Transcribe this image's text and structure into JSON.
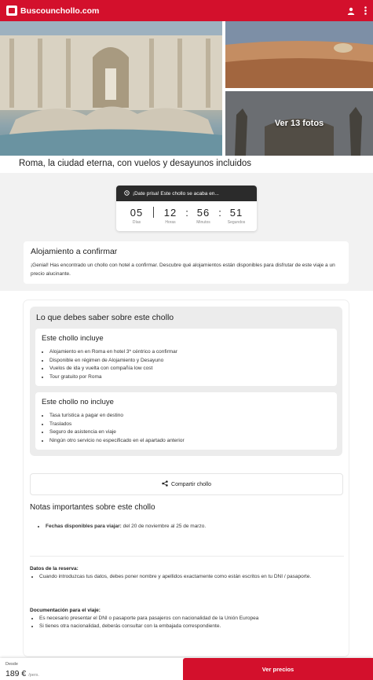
{
  "header": {
    "logo_text": "Buscounchollo.com",
    "brand_color": "#d3102c",
    "icons": [
      "user-icon",
      "menu-icon"
    ]
  },
  "gallery": {
    "more_photos": "Ver 13 fotos"
  },
  "title": "Roma, la ciudad eterna, con vuelos y desayunos incluidos",
  "countdown": {
    "header": "¡Date prisa! Este chollo se acaba en...",
    "units": [
      {
        "value": "05",
        "label": "Días"
      },
      {
        "value": "12",
        "label": "Horas"
      },
      {
        "value": "56",
        "label": "Minutos"
      },
      {
        "value": "51",
        "label": "Segundos"
      }
    ]
  },
  "alojamiento": {
    "heading": "Alojamiento a confirmar",
    "text": "¡Genial! Has encontrado un chollo con hotel a confirmar. Descubre qué alojamientos están disponibles para disfrutar de este viaje a un precio alucinante."
  },
  "saber": {
    "heading": "Lo que debes saber sobre este chollo",
    "incluye": {
      "heading": "Este chollo incluye",
      "items": [
        "Alojamiento en en Roma en hotel 3* céntrico a confirmar",
        "Disponible en régimen de Alojamiento y Desayuno",
        "Vuelos de ida y vuelta con compañía low cost",
        "Tour gratuito por Roma"
      ]
    },
    "no_incluye": {
      "heading": "Este chollo no incluye",
      "items": [
        "Tasa turística a pagar en destino",
        "Traslados",
        "Seguro de asistencia en viaje",
        "Ningún otro servicio no especificado en el apartado anterior"
      ]
    }
  },
  "share_label": "Compartir chollo",
  "notas": {
    "heading": "Notas importantes sobre este chollo",
    "fechas_label": "Fechas disponibles para viajar:",
    "fechas_value": " del 20 de noviembre al 25 de marzo.",
    "reserva_heading": "Datos de la reserva:",
    "reserva_items": [
      "Cuando introduzcas tus datos, debes poner nombre y apellidos exactamente como están escritos en tu DNI / pasaporte."
    ],
    "documentacion_heading": "Documentación para el viaje:",
    "documentacion_items": [
      "Es necesario presentar el DNI o pasaporte para pasajeros con nacionalidad de la Unión Europea",
      "Si tienes otra nacionalidad, deberás consultar con la embajada correspondiente."
    ]
  },
  "footer": {
    "from_label": "Desde",
    "price": "189 €",
    "per_label": "/pers.",
    "cta_label": "Ver precios"
  }
}
